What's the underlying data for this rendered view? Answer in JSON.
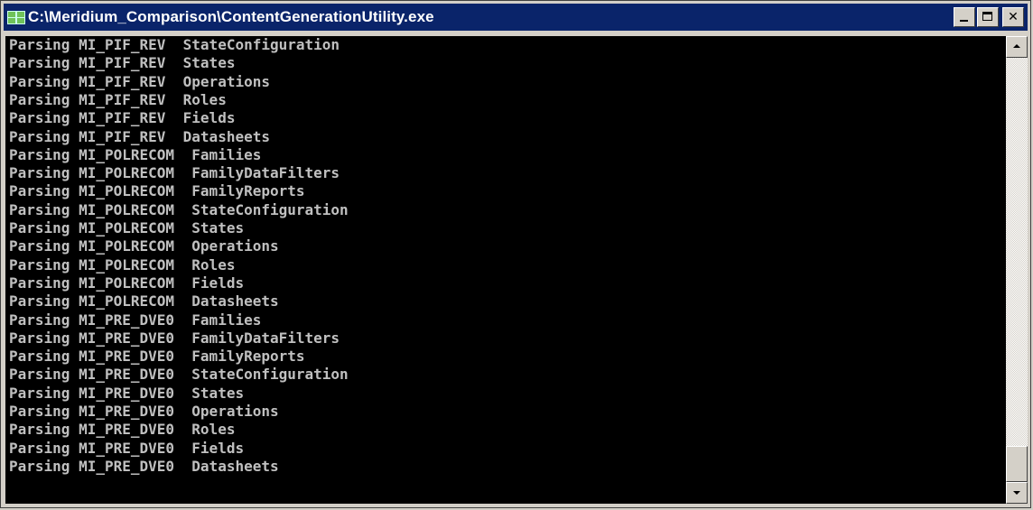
{
  "window": {
    "title": "C:\\Meridium_Comparison\\ContentGenerationUtility.exe",
    "icon": "console-app-icon",
    "title_bar_color": "#0a246a",
    "controls": {
      "minimize_icon": "minimize-icon",
      "maximize_icon": "maximize-icon",
      "close_icon": "close-icon",
      "close_glyph": "✕"
    }
  },
  "console": {
    "background": "#000000",
    "text_color": "#c0c0c0",
    "lines": [
      "Parsing MI_PIF_REV  StateConfiguration",
      "Parsing MI_PIF_REV  States",
      "Parsing MI_PIF_REV  Operations",
      "Parsing MI_PIF_REV  Roles",
      "Parsing MI_PIF_REV  Fields",
      "Parsing MI_PIF_REV  Datasheets",
      "Parsing MI_POLRECOM  Families",
      "Parsing MI_POLRECOM  FamilyDataFilters",
      "Parsing MI_POLRECOM  FamilyReports",
      "Parsing MI_POLRECOM  StateConfiguration",
      "Parsing MI_POLRECOM  States",
      "Parsing MI_POLRECOM  Operations",
      "Parsing MI_POLRECOM  Roles",
      "Parsing MI_POLRECOM  Fields",
      "Parsing MI_POLRECOM  Datasheets",
      "Parsing MI_PRE_DVE0  Families",
      "Parsing MI_PRE_DVE0  FamilyDataFilters",
      "Parsing MI_PRE_DVE0  FamilyReports",
      "Parsing MI_PRE_DVE0  StateConfiguration",
      "Parsing MI_PRE_DVE0  States",
      "Parsing MI_PRE_DVE0  Operations",
      "Parsing MI_PRE_DVE0  Roles",
      "Parsing MI_PRE_DVE0  Fields",
      "Parsing MI_PRE_DVE0  Datasheets"
    ]
  },
  "scrollbar": {
    "up_icon": "scroll-up-arrow-icon",
    "down_icon": "scroll-down-arrow-icon",
    "position": 1.0
  }
}
